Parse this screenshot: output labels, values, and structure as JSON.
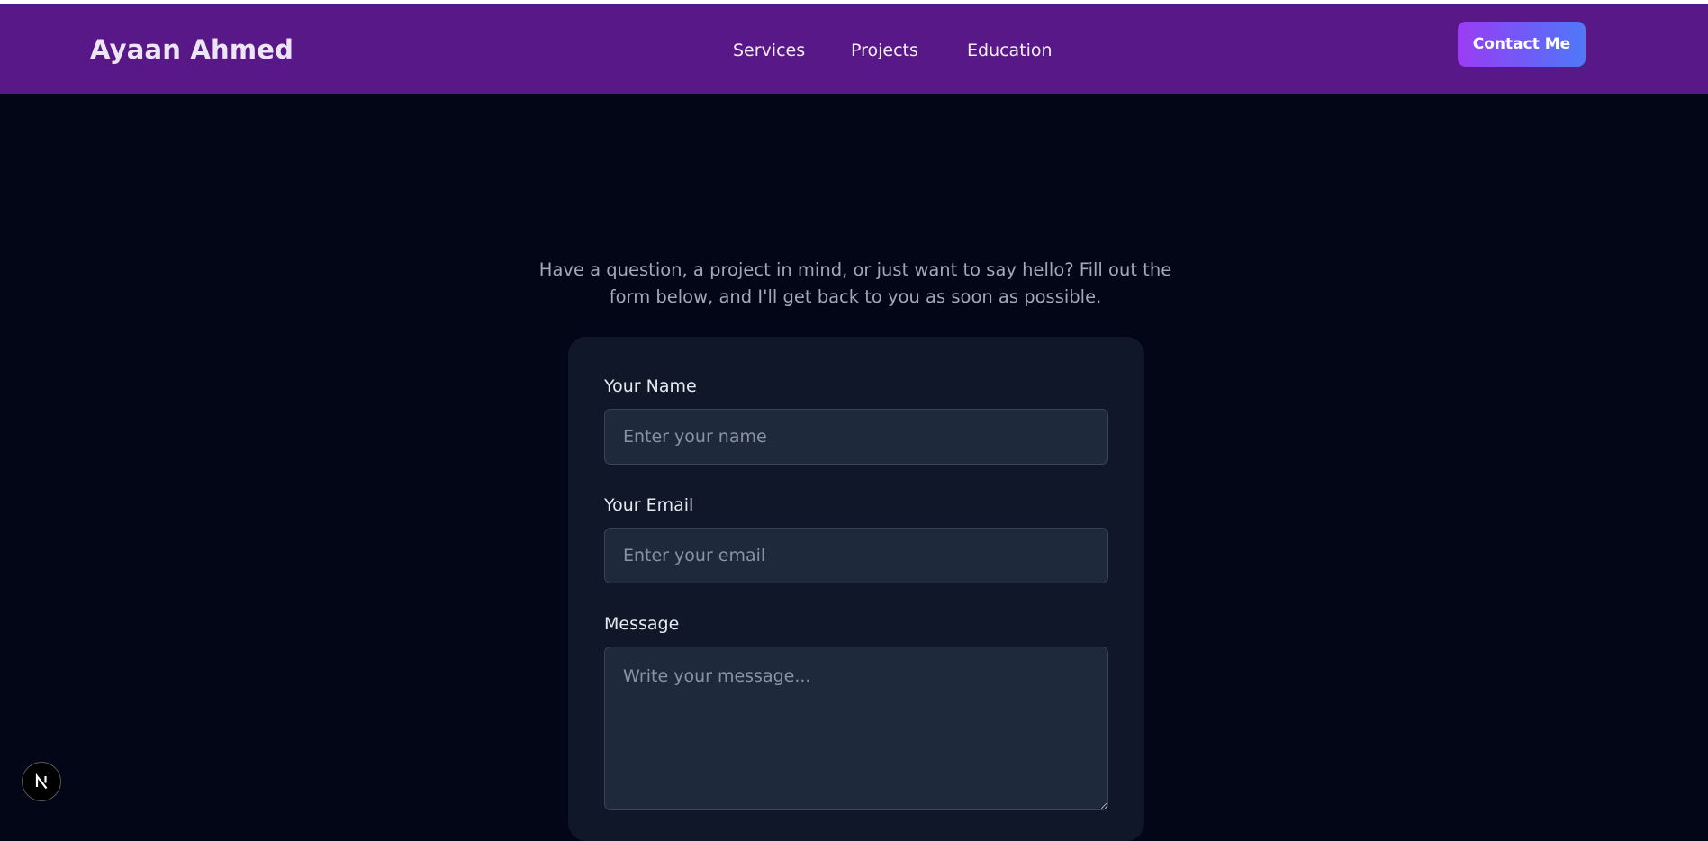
{
  "nav": {
    "brand": "Ayaan Ahmed",
    "links": [
      "Services",
      "Projects",
      "Education"
    ],
    "contact_button": "Contact Me"
  },
  "intro": {
    "text": "Have a question, a project in mind, or just want to say hello? Fill out the form below, and I'll get back to you as soon as possible."
  },
  "form": {
    "name": {
      "label": "Your Name",
      "placeholder": "Enter your name"
    },
    "email": {
      "label": "Your Email",
      "placeholder": "Enter your email"
    },
    "message": {
      "label": "Message",
      "placeholder": "Write your message..."
    }
  },
  "dev_badge": {
    "icon": "nextjs-logo-icon",
    "glyph": "N"
  },
  "colors": {
    "navbar": "#581887",
    "background": "#030617",
    "card": "#0f1729",
    "input": "#1e293b",
    "button_gradient_start": "#9b3cf4",
    "button_gradient_end": "#4f79f7"
  }
}
